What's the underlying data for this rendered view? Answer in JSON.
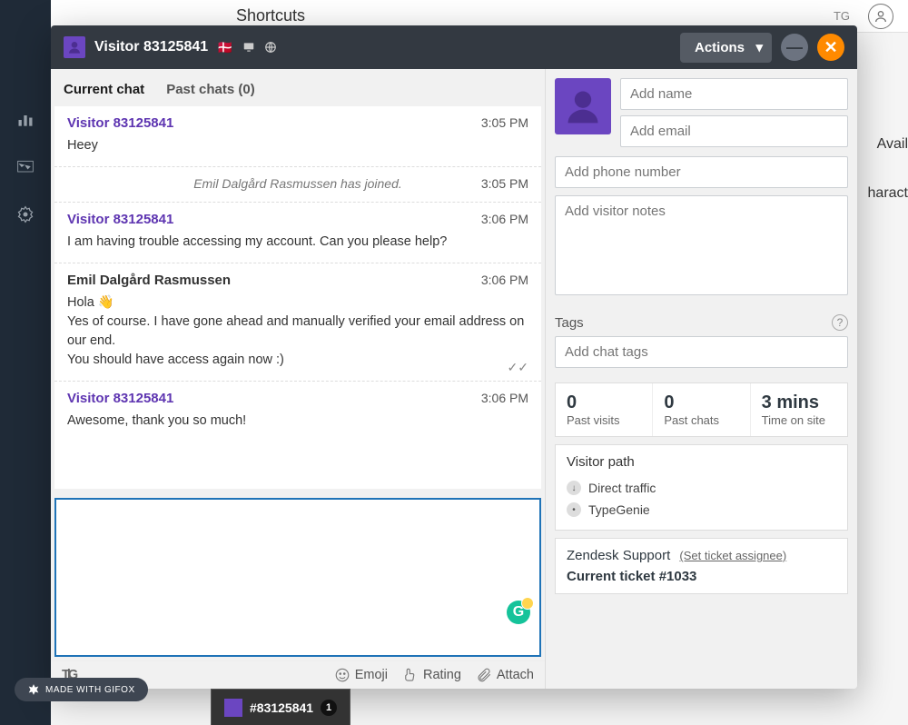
{
  "underlay": {
    "shortcuts_label": "Shortcuts",
    "right_badge": "TG",
    "availability": "Avail",
    "charact": "haract"
  },
  "gifox": "MADE WITH GIFOX",
  "bottom_tab": {
    "title": "#83125841",
    "badge": "1"
  },
  "modal": {
    "title": "Visitor 83125841",
    "flag": "🇩🇰",
    "actions_label": "Actions"
  },
  "chat_tabs": {
    "current": "Current chat",
    "past": "Past chats (0)"
  },
  "transcript": [
    {
      "type": "visitor",
      "name": "Visitor 83125841",
      "time": "3:05 PM",
      "text": "Heey"
    },
    {
      "type": "system",
      "time": "3:05 PM",
      "text": "Emil Dalgård Rasmussen has joined."
    },
    {
      "type": "visitor",
      "name": "Visitor 83125841",
      "time": "3:06 PM",
      "text": "I am having trouble accessing my account. Can you please help?"
    },
    {
      "type": "agent",
      "name": "Emil Dalgård Rasmussen",
      "time": "3:06 PM",
      "text": "Hola 👋\nYes of course. I have gone ahead and manually verified your email address on our end.\nYou should have access again now :)",
      "read": true
    },
    {
      "type": "visitor",
      "name": "Visitor 83125841",
      "time": "3:06 PM",
      "text": "Awesome, thank you so much!"
    }
  ],
  "composer": {
    "tg_label": "T|G",
    "emoji": "Emoji",
    "rating": "Rating",
    "attach": "Attach"
  },
  "details": {
    "name_placeholder": "Add name",
    "email_placeholder": "Add email",
    "phone_placeholder": "Add phone number",
    "notes_placeholder": "Add visitor notes",
    "tags_label": "Tags",
    "tags_placeholder": "Add chat tags",
    "stats": {
      "past_visits": {
        "val": "0",
        "lbl": "Past visits"
      },
      "past_chats": {
        "val": "0",
        "lbl": "Past chats"
      },
      "time_on_site": {
        "val": "3 mins",
        "lbl": "Time on site"
      }
    },
    "visitor_path": {
      "title": "Visitor path",
      "items": [
        "Direct traffic",
        "TypeGenie"
      ]
    },
    "support": {
      "title": "Zendesk Support",
      "assignee_link": "(Set ticket assignee)",
      "ticket_title": "Current ticket #1033"
    }
  }
}
